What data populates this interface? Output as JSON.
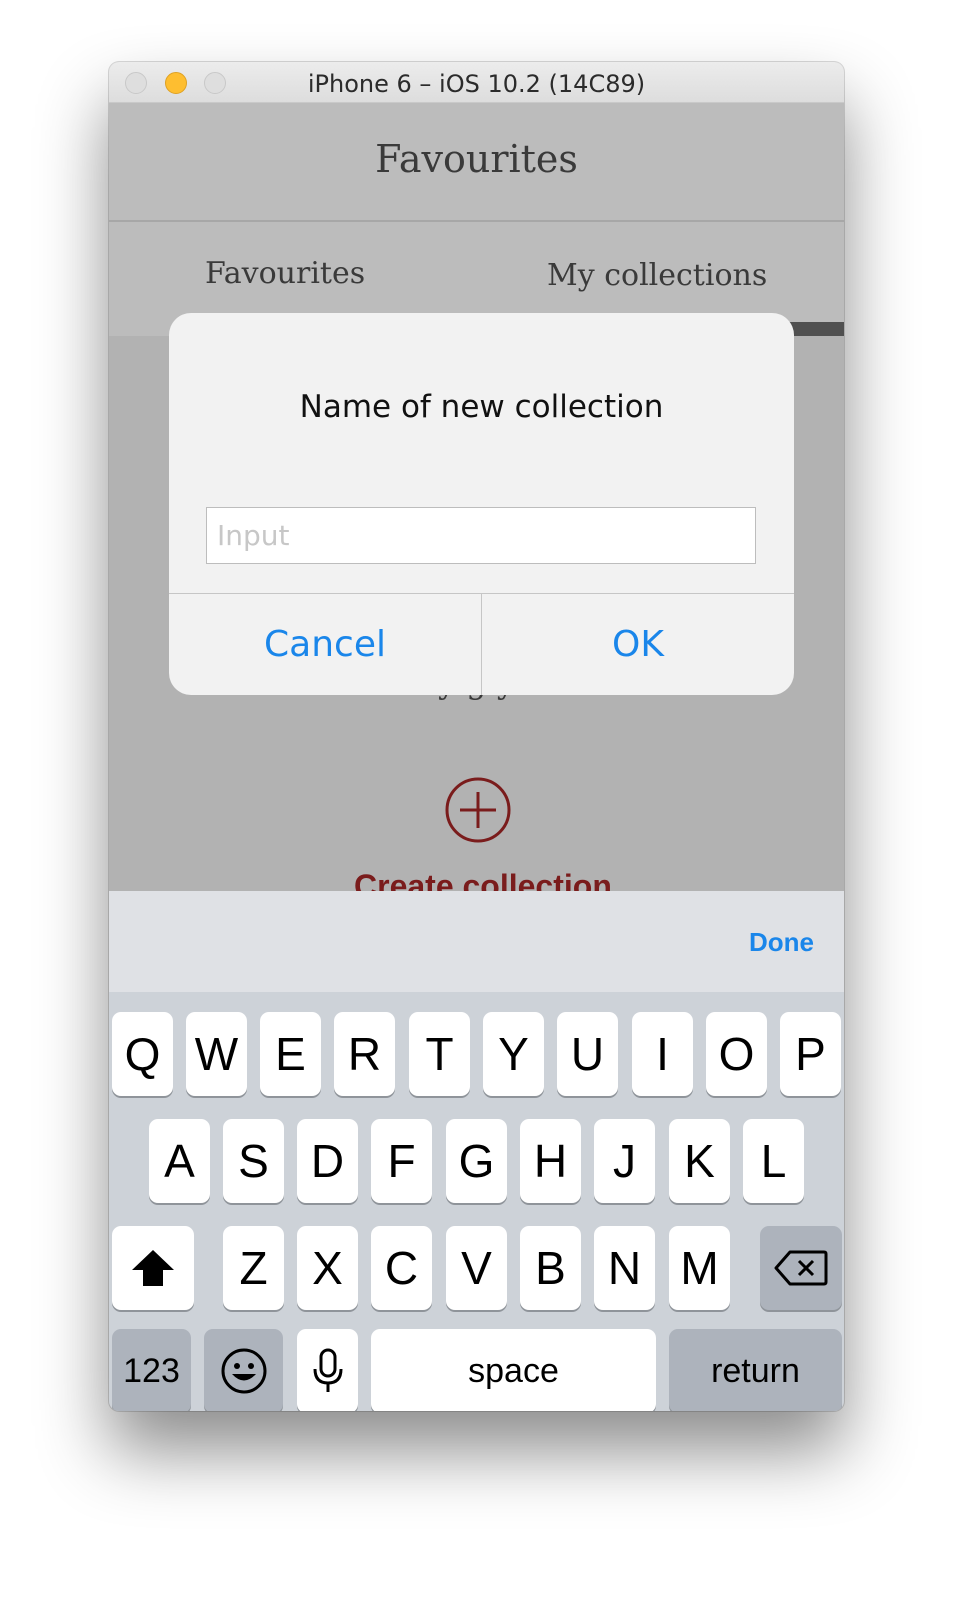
{
  "window": {
    "title": "iPhone 6 – iOS 10.2 (14C89)"
  },
  "app": {
    "title": "Favourites",
    "tabs": [
      {
        "label": "Favourites"
      },
      {
        "label": "My collections"
      }
    ],
    "content_partial": "y   g      y",
    "create_label": "Create collection"
  },
  "dialog": {
    "title": "Name of new collection",
    "input_placeholder": "Input",
    "input_value": "",
    "cancel_label": "Cancel",
    "ok_label": "OK"
  },
  "keyboard": {
    "done_label": "Done",
    "row1": [
      "Q",
      "W",
      "E",
      "R",
      "T",
      "Y",
      "U",
      "I",
      "O",
      "P"
    ],
    "row2": [
      "A",
      "S",
      "D",
      "F",
      "G",
      "H",
      "J",
      "K",
      "L"
    ],
    "row3": [
      "Z",
      "X",
      "C",
      "V",
      "B",
      "N",
      "M"
    ],
    "numbers_label": "123",
    "space_label": "space",
    "return_label": "return",
    "icons": {
      "shift": "shift-icon",
      "delete": "backspace-icon",
      "emoji": "emoji-icon",
      "mic": "microphone-icon"
    }
  },
  "colors": {
    "accent": "#1a86ea",
    "brand": "#7a1c1c",
    "tab_indicator": "#505050"
  }
}
